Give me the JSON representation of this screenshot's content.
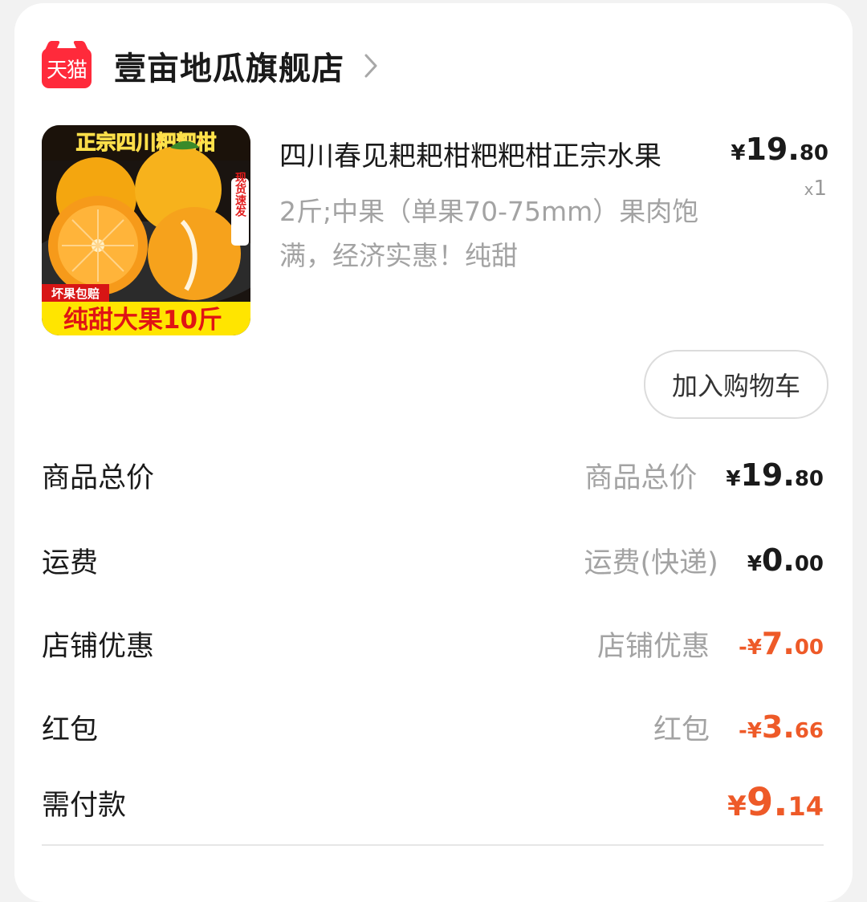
{
  "shop": {
    "badge": "天猫",
    "name": "壹亩地瓜旗舰店",
    "chevron_icon": "chevron-right-icon"
  },
  "product": {
    "image": {
      "top_banner": "正宗四川粑粑柑",
      "side_tag": "现货速发",
      "corner_tag": "坏果包赔",
      "bottom_banner": "纯甜大果10斤"
    },
    "title": "四川春见耙耙柑粑粑柑正宗水果",
    "spec": "2斤;中果（单果70-75mm）果肉饱满，经济实惠！纯甜",
    "price": {
      "symbol": "¥",
      "int": "19.",
      "dec": "80"
    },
    "qty": {
      "prefix": "x",
      "value": "1"
    },
    "add_to_cart": "加入购物车"
  },
  "summary": [
    {
      "label": "商品总价",
      "sub": "商品总价",
      "sign": "",
      "symbol": "¥",
      "int": "19.",
      "dec": "80"
    },
    {
      "label": "运费",
      "sub": "运费(快递)",
      "sign": "",
      "symbol": "¥",
      "int": "0.",
      "dec": "00"
    },
    {
      "label": "店铺优惠",
      "sub": "店铺优惠",
      "sign": "-",
      "symbol": "¥",
      "int": "7.",
      "dec": "00"
    },
    {
      "label": "红包",
      "sub": "红包",
      "sign": "-",
      "symbol": "¥",
      "int": "3.",
      "dec": "66"
    }
  ],
  "total": {
    "label": "需付款",
    "symbol": "¥",
    "int": "9.",
    "dec": "14"
  },
  "colors": {
    "discount": "#ee5a28",
    "tmall_red": "#ff2a3b",
    "muted": "#a3a3a3"
  }
}
